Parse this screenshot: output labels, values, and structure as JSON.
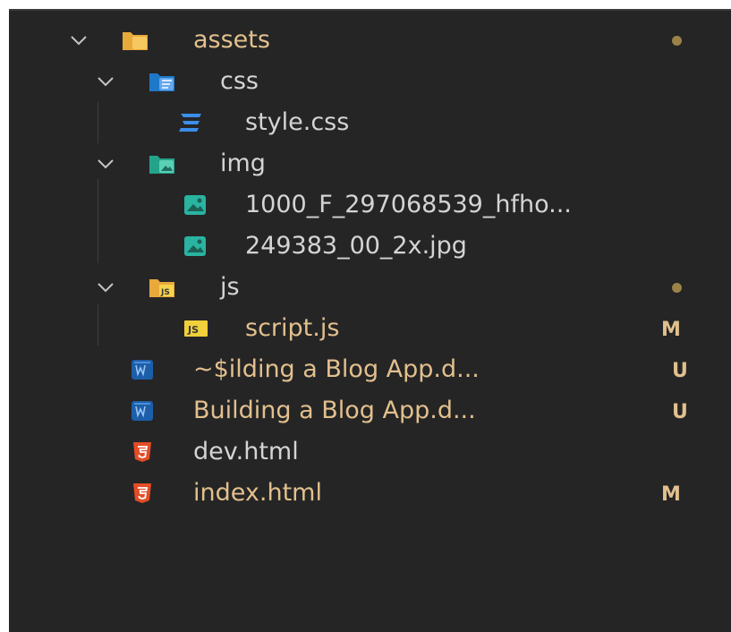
{
  "explorer": {
    "rows": [
      {
        "label": "assets",
        "type": "folder",
        "icon": "folder-assets-icon",
        "badge": "",
        "dot": true
      },
      {
        "label": "css",
        "type": "folder",
        "icon": "folder-css-icon",
        "badge": "",
        "dot": false
      },
      {
        "label": "style.css",
        "type": "file",
        "icon": "css-file-icon",
        "badge": ""
      },
      {
        "label": "img",
        "type": "folder",
        "icon": "folder-images-icon",
        "badge": "",
        "dot": false
      },
      {
        "label": "1000_F_297068539_hfho...",
        "type": "file",
        "icon": "image-file-icon",
        "badge": ""
      },
      {
        "label": "249383_00_2x.jpg",
        "type": "file",
        "icon": "image-file-icon",
        "badge": ""
      },
      {
        "label": "js",
        "type": "folder",
        "icon": "folder-js-icon",
        "badge": "",
        "dot": true
      },
      {
        "label": "script.js",
        "type": "file",
        "icon": "js-file-icon",
        "badge": "M"
      },
      {
        "label": "~$ilding a Blog App.d...",
        "type": "file",
        "icon": "word-file-icon",
        "badge": "U"
      },
      {
        "label": "Building a Blog App.d...",
        "type": "file",
        "icon": "word-file-icon",
        "badge": "U"
      },
      {
        "label": "dev.html",
        "type": "file",
        "icon": "html-file-icon",
        "badge": ""
      },
      {
        "label": "index.html",
        "type": "file",
        "icon": "html-file-icon",
        "badge": "M"
      }
    ]
  },
  "colors": {
    "background": "#252526",
    "git_modified": "#e2c08d",
    "default_text": "#cccccc"
  }
}
